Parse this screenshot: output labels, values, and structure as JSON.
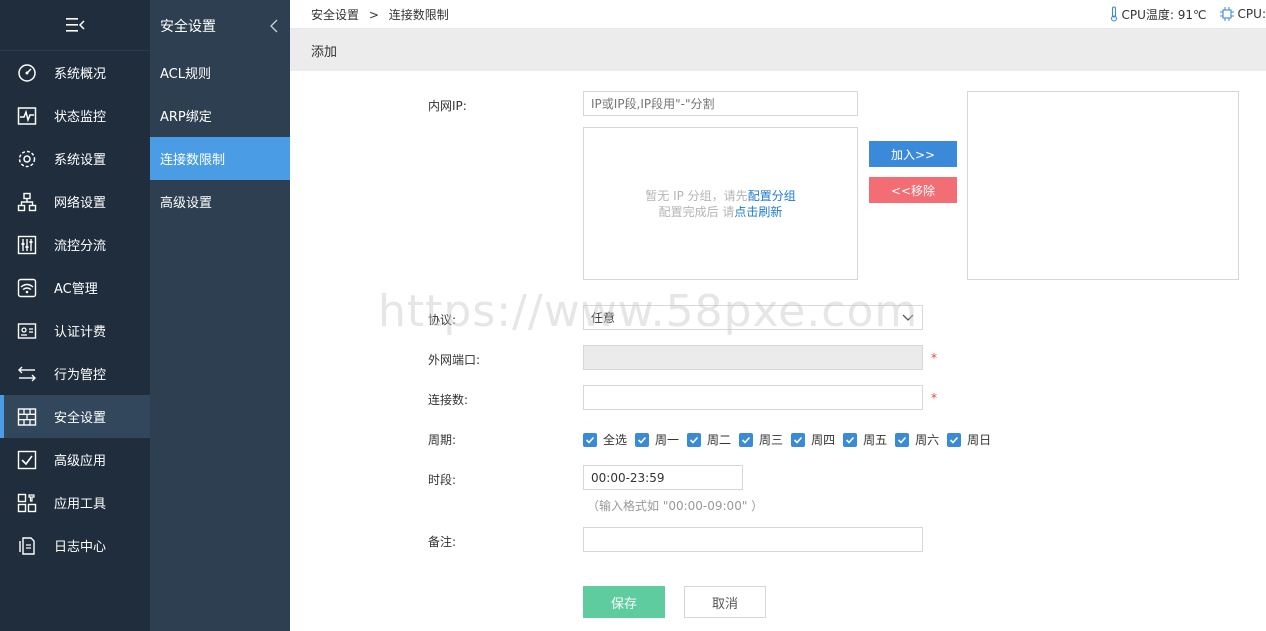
{
  "nav": {
    "items": [
      {
        "label": "系统概况",
        "icon": "gauge-icon"
      },
      {
        "label": "状态监控",
        "icon": "pulse-monitor-icon"
      },
      {
        "label": "系统设置",
        "icon": "gear-icon"
      },
      {
        "label": "网络设置",
        "icon": "network-icon"
      },
      {
        "label": "流控分流",
        "icon": "sliders-icon"
      },
      {
        "label": "AC管理",
        "icon": "wifi-icon"
      },
      {
        "label": "认证计费",
        "icon": "id-card-icon"
      },
      {
        "label": "行为管控",
        "icon": "exchange-icon"
      },
      {
        "label": "安全设置",
        "icon": "firewall-icon",
        "active": true
      },
      {
        "label": "高级应用",
        "icon": "check-square-icon"
      },
      {
        "label": "应用工具",
        "icon": "tools-grid-icon"
      },
      {
        "label": "日志中心",
        "icon": "document-icon"
      }
    ]
  },
  "subnav": {
    "title": "安全设置",
    "items": [
      {
        "label": "ACL规则"
      },
      {
        "label": "ARP绑定"
      },
      {
        "label": "连接数限制",
        "active": true
      },
      {
        "label": "高级设置"
      }
    ]
  },
  "topbar": {
    "breadcrumb": [
      "安全设置",
      ">",
      "连接数限制"
    ],
    "cpu_temp_label": "CPU温度: 91℃",
    "cpu_label": "CPU:"
  },
  "section": {
    "title": "添加"
  },
  "form": {
    "lan_ip_label": "内网IP:",
    "lan_ip_placeholder": "IP或IP段,IP段用\"-\"分割",
    "group_empty_line1_a": "暂无 IP 分组，请先",
    "group_empty_line1_link": "配置分组",
    "group_empty_line2_a": "配置完成后 请",
    "group_empty_line2_link": "点击刷新",
    "add_button": "加入>>",
    "remove_button": "<<移除",
    "protocol_label": "协议:",
    "protocol_value": "任意",
    "wan_port_label": "外网端口:",
    "wan_port_value": "",
    "connections_label": "连接数:",
    "connections_value": "",
    "required_mark": "*",
    "period_label": "周期:",
    "period_options": [
      "全选",
      "周一",
      "周二",
      "周三",
      "周四",
      "周五",
      "周六",
      "周日"
    ],
    "timespan_label": "时段:",
    "timespan_value": "00:00-23:59",
    "timespan_hint": "（输入格式如 \"00:00-09:00\" ）",
    "remark_label": "备注:",
    "remark_value": "",
    "save_button": "保存",
    "cancel_button": "取消"
  },
  "watermark": "https://www.58pxe.com",
  "colors": {
    "nav_bg": "#1f2d3d",
    "subnav_bg": "#2e3f51",
    "accent": "#4a9de4",
    "add_button": "#3b8ad9",
    "remove_button": "#f36d75",
    "save_button": "#5fcca0",
    "link": "#1d7ad0"
  }
}
